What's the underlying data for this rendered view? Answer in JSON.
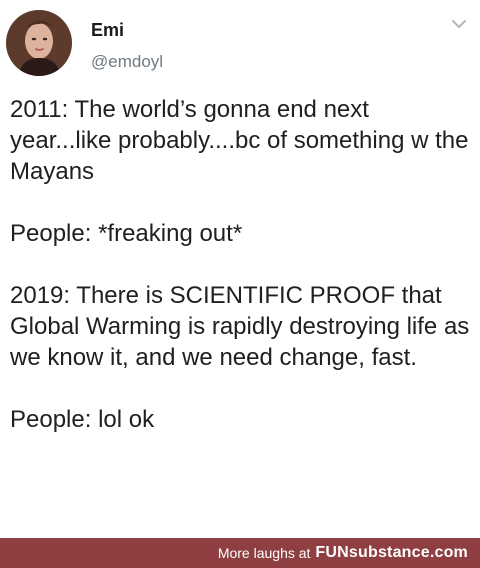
{
  "tweet": {
    "author": {
      "name": "Emi",
      "handle": "@emdoyl"
    },
    "body": [
      "2011: The world’s gonna end next year...like probably....bc of something w the Mayans",
      "People: *freaking out*",
      "2019: There is SCIENTIFIC PROOF that Global Warming is rapidly destroying life as we know it, and we need change, fast.",
      "People: lol ok"
    ]
  },
  "footer": {
    "text": "More laughs at",
    "brand": "FUNsubstance.com"
  },
  "colors": {
    "footer_bg": "#8f3f41",
    "handle_text": "#6f7a84",
    "body_text": "#202020"
  },
  "icons": {
    "avatar": "profile-photo",
    "menu": "chevron-down-icon"
  }
}
